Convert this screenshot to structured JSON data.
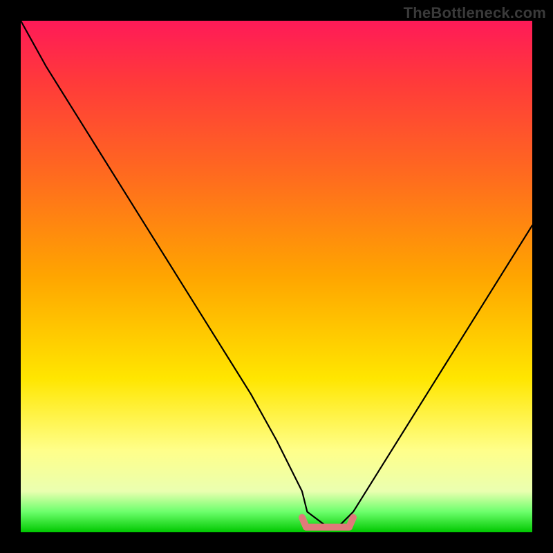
{
  "watermark": "TheBottleneck.com",
  "colors": {
    "curve": "#000000",
    "bottom_mark": "#e07a7a",
    "gradient_top": "#ff1a58",
    "gradient_mid": "#ffe600",
    "gradient_bottom": "#00c800"
  },
  "chart_data": {
    "type": "line",
    "title": "",
    "xlabel": "",
    "ylabel": "",
    "xlim": [
      0,
      100
    ],
    "ylim": [
      0,
      100
    ],
    "grid": false,
    "series": [
      {
        "name": "bottleneck-curve",
        "x": [
          0,
          5,
          10,
          15,
          20,
          25,
          30,
          35,
          40,
          45,
          50,
          55,
          56,
          60,
          62,
          65,
          70,
          75,
          80,
          85,
          90,
          95,
          100
        ],
        "values": [
          100,
          91,
          83,
          75,
          67,
          59,
          51,
          43,
          35,
          27,
          18,
          8,
          4,
          1,
          1,
          4,
          12,
          20,
          28,
          36,
          44,
          52,
          60
        ]
      }
    ],
    "annotations": [
      {
        "name": "flat-bottom-marker",
        "x_range": [
          55,
          65
        ],
        "y": 1,
        "color": "#e07a7a"
      }
    ]
  }
}
